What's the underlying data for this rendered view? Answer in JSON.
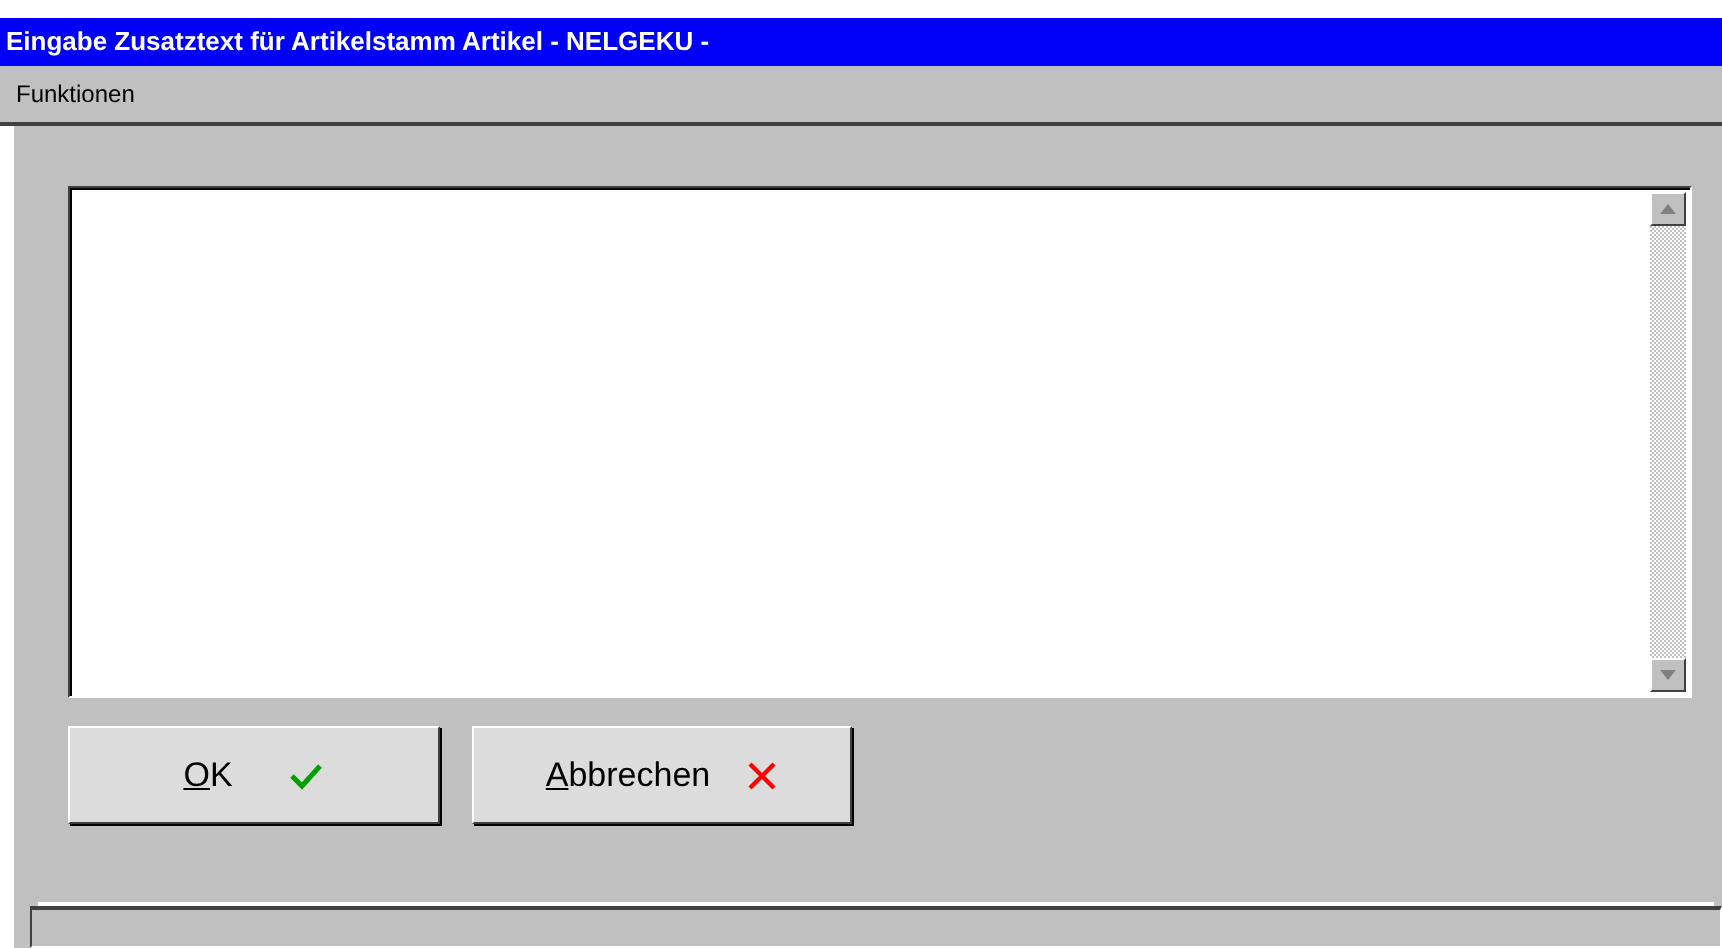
{
  "window": {
    "title": "Eingabe Zusatztext für Artikelstamm Artikel - NELGEKU -"
  },
  "menu": [
    "Funktionen"
  ],
  "buttons": [
    {
      "label": "OK",
      "kind": "ok"
    },
    {
      "label": "Abbrechen",
      "kind": "cancel"
    }
  ]
}
